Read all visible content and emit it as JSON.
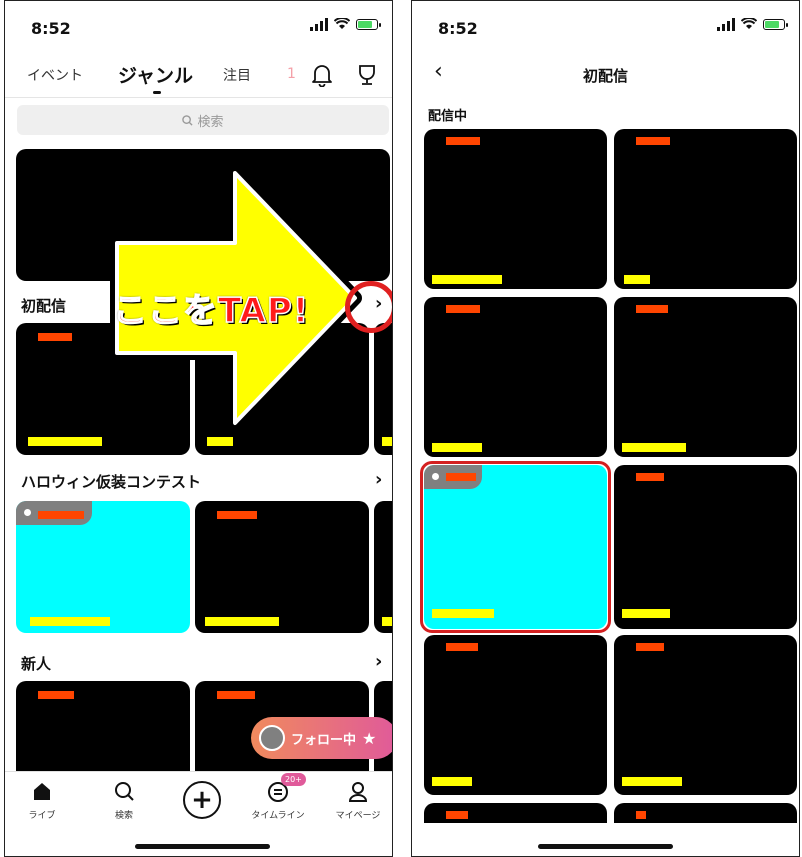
{
  "left": {
    "status": {
      "time": "8:52"
    },
    "tabs": [
      "イベント",
      "ジャンル",
      "注目"
    ],
    "notification_count": "1",
    "search_placeholder": "検索",
    "sections": [
      {
        "title": "初配信"
      },
      {
        "title": "ハロウィン仮装コンテスト"
      },
      {
        "title": "新人"
      }
    ],
    "overlay_text": "ここをTAP!",
    "follow_button_label": "フォロー中",
    "nav": [
      {
        "label": "ライブ",
        "icon": "home-icon"
      },
      {
        "label": "検索",
        "icon": "search-icon"
      },
      {
        "label": "",
        "icon": "plus-icon"
      },
      {
        "label": "タイムライン",
        "icon": "timeline-icon"
      },
      {
        "label": "マイページ",
        "icon": "person-icon"
      }
    ],
    "timeline_badge": "20+"
  },
  "right": {
    "status": {
      "time": "8:52"
    },
    "title": "初配信",
    "section_title": "配信中"
  },
  "colors": {
    "card": "#000000",
    "live_card": "#00ffff",
    "title_bar": "#ff4500",
    "viewer_bar": "#ffff00",
    "highlight": "#d42020",
    "follow_gradient_start": "#f08a5d",
    "follow_gradient_end": "#e05a9a"
  }
}
